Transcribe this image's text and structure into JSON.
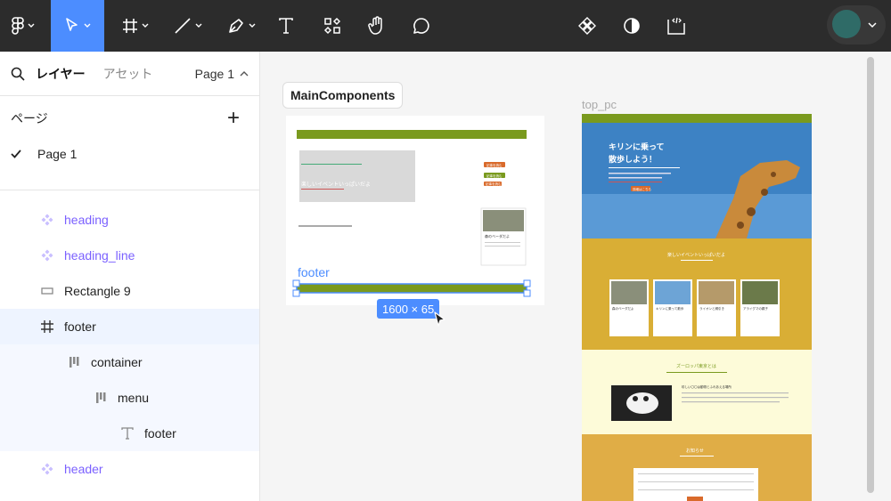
{
  "toolbar": {
    "tools": [
      "figma-menu",
      "move",
      "frame",
      "line",
      "pen",
      "text",
      "components",
      "hand",
      "comment"
    ],
    "right_tools": [
      "component-set",
      "theme",
      "dev-mode"
    ]
  },
  "panel": {
    "tab_layers": "レイヤー",
    "tab_assets": "アセット",
    "page_selector": "Page 1",
    "pages_title": "ページ",
    "add_page": "+",
    "current_page": "Page 1",
    "layers": [
      {
        "label": "heading",
        "icon": "component-icon"
      },
      {
        "label": "heading_line",
        "icon": "component-icon"
      },
      {
        "label": "Rectangle 9",
        "icon": "rectangle-icon"
      },
      {
        "label": "footer",
        "icon": "frame-icon"
      },
      {
        "label": "container",
        "icon": "autolayout-icon"
      },
      {
        "label": "menu",
        "icon": "autolayout-icon"
      },
      {
        "label": "footer",
        "icon": "text-icon"
      },
      {
        "label": "header",
        "icon": "component-icon"
      }
    ]
  },
  "canvas": {
    "main_components_label": "MainComponents",
    "top_pc_label": "top_pc",
    "footer_selection_label": "footer",
    "dimension_badge": "1600 × 65",
    "mock": {
      "mc_event_title": "楽しいイベントいっぱいだよ",
      "mc_tag1": "記事を読む",
      "mc_tag2": "記事を読む",
      "mc_tag3": "記事を読む",
      "mc_card_title": "森のベーダだよ",
      "hero_title_1": "キリンに乗って",
      "hero_title_2": "散歩しよう！",
      "hero_sub": "世界で一番キリンとふれあえる\n動物園へ遊びに来てください",
      "hero_btn": "詳細はこちら",
      "event_title": "楽しいイベントいっぱいだよ",
      "cards": [
        "森のベーダだよ",
        "キリンに乗って散歩",
        "ライオンと綱引き",
        "アライグマの親子"
      ],
      "about_title": "ズーロッパ東京とは",
      "about_sub": "珍しい〇〇は動物とふれあえる場所",
      "news_title": "お知らせ"
    }
  }
}
